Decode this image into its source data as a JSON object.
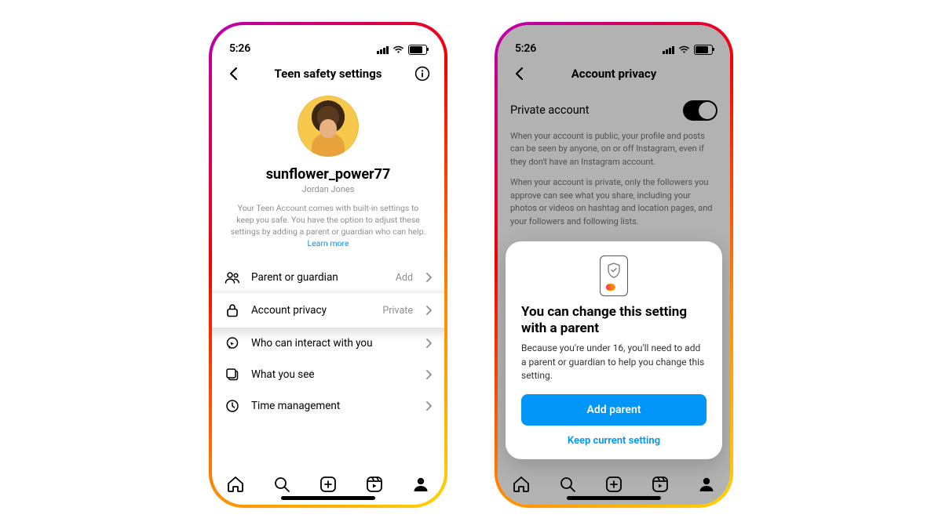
{
  "status": {
    "time": "5:26"
  },
  "phone1": {
    "header": {
      "title": "Teen safety settings"
    },
    "profile": {
      "username": "sunflower_power77",
      "displayname": "Jordan Jones",
      "blurb": "Your Teen Account comes with built-in settings to keep you safe. You have the option to adjust these settings by adding a parent or guardian who can help.",
      "learn_more": "Learn more"
    },
    "rows": {
      "parent": {
        "label": "Parent or guardian",
        "trailing": "Add"
      },
      "privacy": {
        "label": "Account privacy",
        "trailing": "Private"
      },
      "interact": {
        "label": "Who can interact with you"
      },
      "see": {
        "label": "What you see"
      },
      "time": {
        "label": "Time management"
      }
    }
  },
  "phone2": {
    "header": {
      "title": "Account privacy"
    },
    "row_label": "Private account",
    "desc1": "When your account is public, your profile and posts can be seen by anyone, on or off Instagram, even if they don't have an Instagram account.",
    "desc2": "When your account is private, only the followers you approve can see what you share, including your photos or videos on hashtag and location pages, and your followers and following lists.",
    "sheet": {
      "title": "You can change this setting with a parent",
      "body": "Because you're under 16, you'll need to add a parent or guardian to help you change this setting.",
      "primary": "Add parent",
      "secondary": "Keep current setting"
    }
  }
}
